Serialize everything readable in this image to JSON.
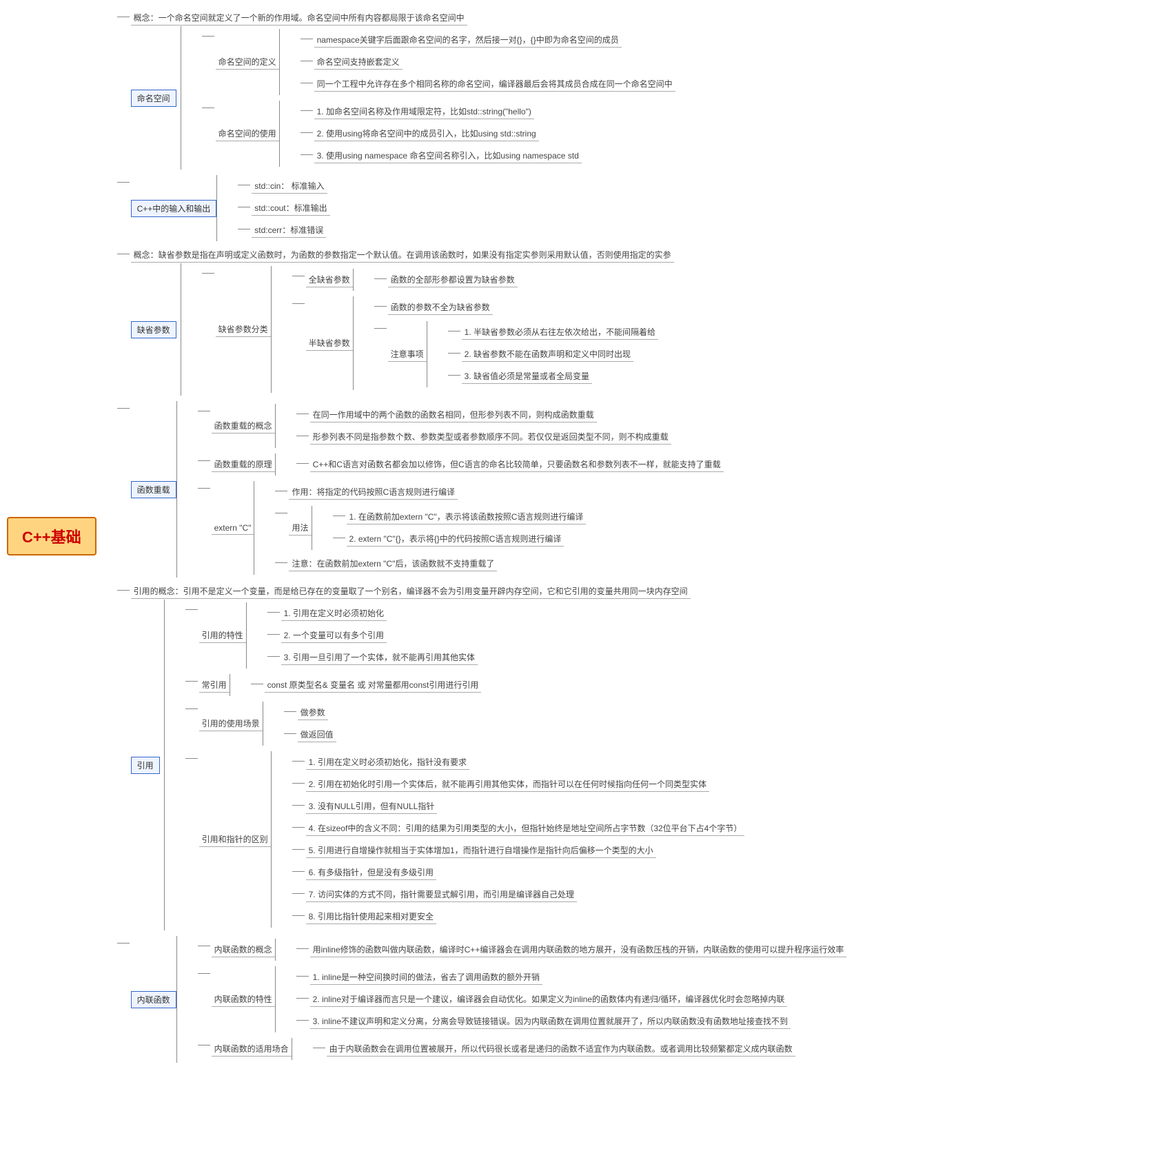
{
  "root": "C++基础",
  "n1": {
    "t": "命名空间",
    "c": "概念：一个命名空间就定义了一个新的作用域。命名空间中所有内容都局限于该命名空间中",
    "d": {
      "t": "命名空间的定义",
      "i": [
        "namespace关键字后面跟命名空间的名字，然后接一对{}，{}中即为命名空间的成员",
        "命名空间支持嵌套定义",
        "同一个工程中允许存在多个相同名称的命名空间，编译器最后会将其成员合成在同一个命名空间中"
      ]
    },
    "u": {
      "t": "命名空间的使用",
      "i": [
        "1. 加命名空间名称及作用域限定符，比如std::string(\"hello\")",
        "2. 使用using将命名空间中的成员引入，比如using std::string",
        "3. 使用using namespace 命名空间名称引入，比如using namespace std"
      ]
    }
  },
  "n2": {
    "t": "C++中的输入和输出",
    "i": [
      "std::cin： 标准输入",
      "std::cout：标准输出",
      "std:cerr：标准错误"
    ]
  },
  "n3": {
    "t": "缺省参数",
    "c": "概念：缺省参数是指在声明或定义函数时，为函数的参数指定一个默认值。在调用该函数时，如果没有指定实参则采用默认值，否则使用指定的实参",
    "cl": {
      "t": "缺省参数分类",
      "f": {
        "t": "全缺省参数",
        "d": "函数的全部形参都设置为缺省参数"
      },
      "h": {
        "t": "半缺省参数",
        "d": "函数的参数不全为缺省参数",
        "att": {
          "t": "注意事项",
          "i": [
            "1. 半缺省参数必须从右往左依次给出，不能间隔着给",
            "2. 缺省参数不能在函数声明和定义中同时出现",
            "3. 缺省值必须是常量或者全局变量"
          ]
        }
      }
    }
  },
  "n4": {
    "t": "函数重载",
    "ov": {
      "t": "函数重载的概念",
      "i": [
        "在同一作用域中的两个函数的函数名相同，但形参列表不同，则构成函数重载",
        "形参列表不同是指参数个数、参数类型或者参数顺序不同。若仅仅是返回类型不同，则不构成重载"
      ]
    },
    "pr": {
      "t": "函数重载的原理",
      "d": "C++和C语言对函数名都会加以修饰，但C语言的命名比较简单，只要函数名和参数列表不一样，就能支持了重载"
    },
    "ex": {
      "t": "extern \"C\"",
      "a": "作用：将指定的代码按照C语言规则进行编译",
      "u": {
        "t": "用法",
        "i": [
          "1. 在函数前加extern \"C\"，表示将该函数按照C语言规则进行编译",
          "2. extern \"C\"{}，表示将{}中的代码按照C语言规则进行编译"
        ]
      },
      "n": "注意：在函数前加extern \"C\"后，该函数就不支持重载了"
    }
  },
  "n5": {
    "t": "引用",
    "c": "引用的概念：引用不是定义一个变量，而是给已存在的变量取了一个别名，编译器不会为引用变量开辟内存空间，它和它引用的变量共用同一块内存空间",
    "ch": {
      "t": "引用的特性",
      "i": [
        "1. 引用在定义时必须初始化",
        "2. 一个变量可以有多个引用",
        "3. 引用一旦引用了一个实体，就不能再引用其他实体"
      ]
    },
    "cr": {
      "t": "常引用",
      "d": "const 原类型名& 变量名 或 对常量都用const引用进行引用"
    },
    "us": {
      "t": "引用的使用场景",
      "i": [
        "做参数",
        "做返回值"
      ]
    },
    "df": {
      "t": "引用和指针的区别",
      "i": [
        "1. 引用在定义时必须初始化，指针没有要求",
        "2. 引用在初始化时引用一个实体后，就不能再引用其他实体，而指针可以在任何时候指向任何一个同类型实体",
        "3. 没有NULL引用，但有NULL指针",
        "4. 在sizeof中的含义不同：引用的结果为引用类型的大小，但指针始终是地址空间所占字节数（32位平台下占4个字节）",
        "5. 引用进行自增操作就相当于实体增加1，而指针进行自增操作是指针向后偏移一个类型的大小",
        "6. 有多级指针，但是没有多级引用",
        "7. 访问实体的方式不同，指针需要显式解引用，而引用是编译器自己处理",
        "8. 引用比指针使用起来相对更安全"
      ]
    }
  },
  "n6": {
    "t": "内联函数",
    "c": {
      "t": "内联函数的概念",
      "d": "用inline修饰的函数叫做内联函数，编译时C++编译器会在调用内联函数的地方展开，没有函数压栈的开销，内联函数的使用可以提升程序运行效率"
    },
    "ch": {
      "t": "内联函数的特性",
      "i": [
        "1. inline是一种空间换时间的做法，省去了调用函数的额外开销",
        "2. inline对于编译器而言只是一个建议，编译器会自动优化。如果定义为inline的函数体内有递归/循环，编译器优化时会忽略掉内联",
        "3. inline不建议声明和定义分离，分离会导致链接错误。因为内联函数在调用位置就展开了，所以内联函数没有函数地址接查找不到"
      ]
    },
    "us": {
      "t": "内联函数的适用场合",
      "d": "由于内联函数会在调用位置被展开，所以代码很长或者是递归的函数不适宜作为内联函数。或者调用比较频繁都定义成内联函数"
    }
  }
}
